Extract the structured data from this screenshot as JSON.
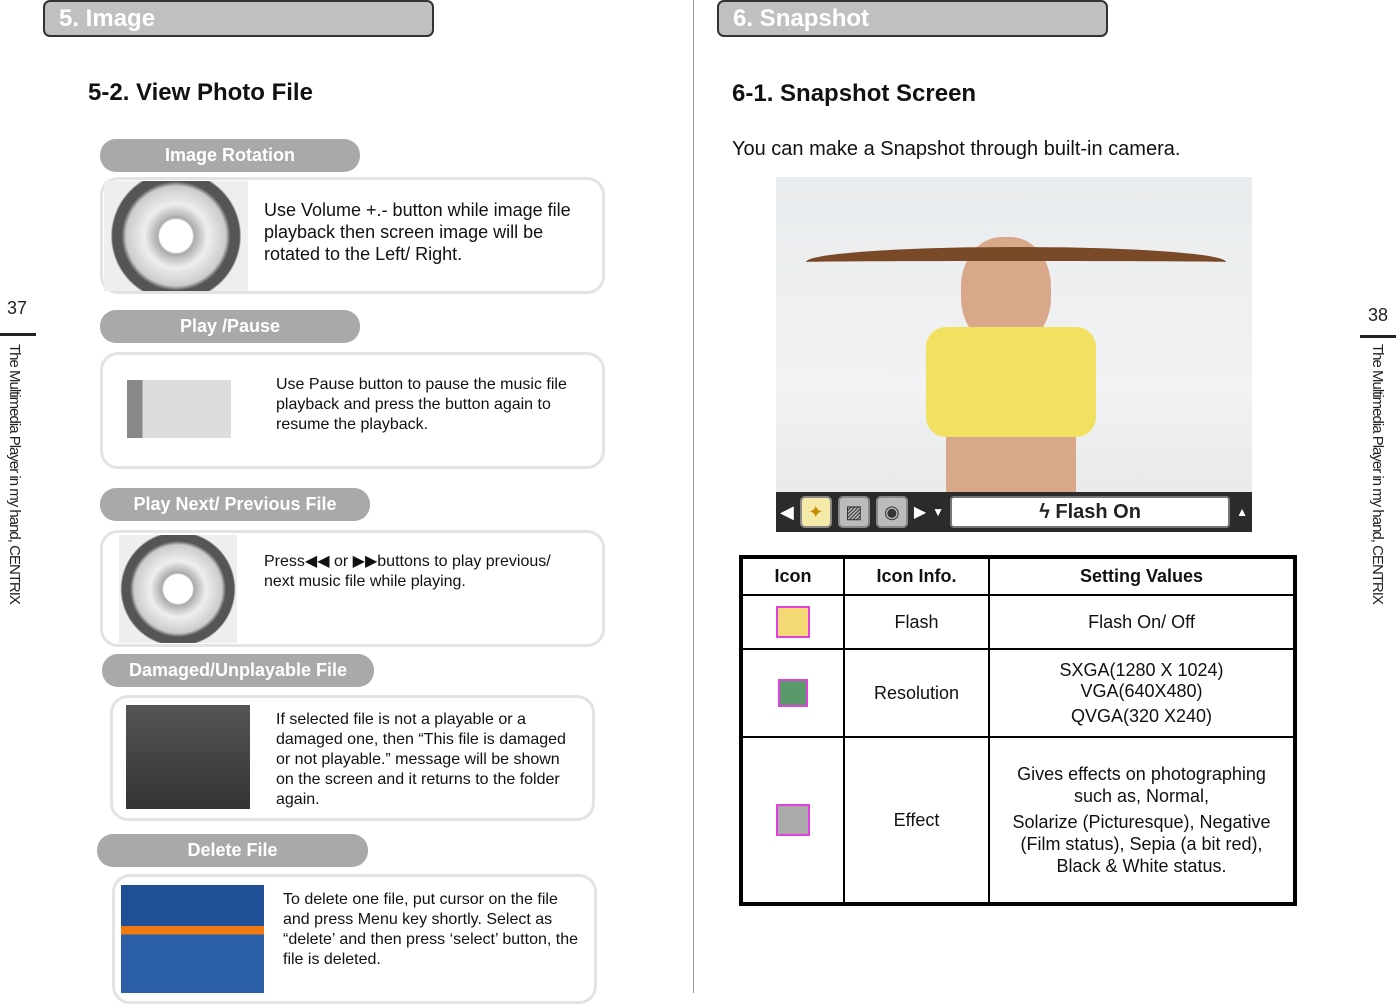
{
  "left_page": {
    "chapter": "5. Image",
    "section": "5-2. View Photo File",
    "page_number": "37",
    "side_text": "The Multimedia Player in my hand, CENTRIX",
    "items": [
      {
        "title": "Image Rotation",
        "text": "Use Volume +.- button while image file playback then screen image will be rotated to the Left/ Right.",
        "icon": "dial-pad-icon"
      },
      {
        "title": "Play /Pause",
        "text": "Use Pause button to pause the music file playback and press the button again to resume the playback.",
        "icon": "pause-button-icon"
      },
      {
        "title": "Play Next/ Previous File",
        "text_a": "Press",
        "text_b": "or",
        "text_c": "buttons to play  previous/ next music file while playing.",
        "icon": "dial-pad-icon"
      },
      {
        "title": "Damaged/Unplayable File",
        "text": "If selected file is not a playable or a damaged one, then “This file is damaged or not playable.” message will be shown on the screen and it returns to the folder again.",
        "icon": "video-box-screenshot"
      },
      {
        "title": "Delete File",
        "text": "To delete one file, put cursor on the file and press Menu key shortly. Select as “delete’ and  then press ‘select’ button, the file is deleted.",
        "icon": "music-box-screenshot"
      }
    ]
  },
  "right_page": {
    "chapter": "6. Snapshot",
    "section": "6-1. Snapshot Screen",
    "intro": "You can make a Snapshot through built-in camera.",
    "page_number": "38",
    "side_text": "The Multimedia Player in my hand, CENTRIX",
    "camera_toolbar": {
      "status": "Flash On",
      "icons": [
        "left-arrow-icon",
        "flash-icon",
        "resolution-icon",
        "effect-icon",
        "right-arrow-icon",
        "down-arrow-icon",
        "up-arrow-icon"
      ]
    },
    "table": {
      "headers": [
        "Icon",
        "Icon Info.",
        "Setting Values"
      ],
      "rows": [
        {
          "icon": "flash-icon",
          "info": "Flash",
          "values": [
            "Flash On/ Off"
          ]
        },
        {
          "icon": "resolution-icon",
          "info": "Resolution",
          "values": [
            "SXGA(1280 X 1024)",
            "VGA(640X480)",
            "QVGA(320 X240)"
          ]
        },
        {
          "icon": "effect-icon",
          "info": "Effect",
          "values": [
            "Gives effects on photographing such as, Normal,",
            "Solarize (Picturesque), Negative (Film status), Sepia (a bit red), Black & White status."
          ]
        }
      ]
    }
  },
  "colors": {
    "chapter_bg": "#c0c0c0",
    "pill_bg": "#a9a9a9",
    "icon_border": "#e040e0"
  }
}
